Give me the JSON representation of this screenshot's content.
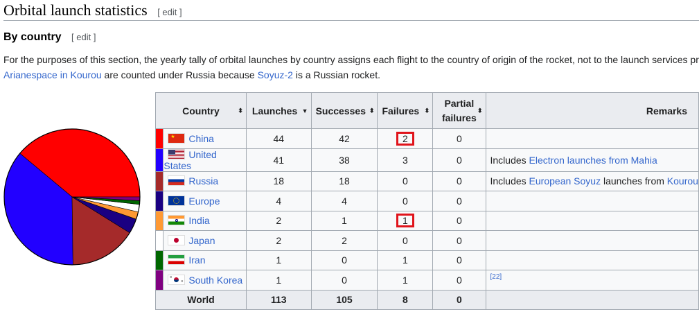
{
  "heading": {
    "title": "Orbital launch statistics",
    "edit": "[ edit ]"
  },
  "subheading": {
    "title": "By country",
    "edit": "[ edit ]"
  },
  "paragraph": {
    "line1": "For the purposes of this section, the yearly tally of orbital launches by country assigns each flight to the country of origin of the rocket, not to the launch services pr",
    "link1": "Arianespace in Kourou",
    "mid": " are counted under Russia because ",
    "link2": "Soyuz-2",
    "end": " is a Russian rocket."
  },
  "table": {
    "headers": {
      "country": "Country",
      "launches": "Launches",
      "successes": "Successes",
      "failures": "Failures",
      "partial1": "Partial",
      "partial2": "failures",
      "remarks": "Remarks"
    },
    "rows": [
      {
        "country": "China",
        "launches": "44",
        "successes": "42",
        "failures": "2",
        "partial": "0",
        "color": "#ff0000",
        "flag": "china"
      },
      {
        "country": "United States",
        "launches": "41",
        "successes": "38",
        "failures": "3",
        "partial": "0",
        "color": "#2200ff",
        "flag": "usa",
        "remark_pre": "Includes ",
        "remark_link": "Electron launches from Mahia",
        "remark_post": ""
      },
      {
        "country": "Russia",
        "launches": "18",
        "successes": "18",
        "failures": "0",
        "partial": "0",
        "color": "#a52a2a",
        "flag": "russia",
        "remark_pre": "Includes ",
        "remark_link": "European Soyuz",
        "remark_post": " launches from ",
        "remark_link2": "Kourou"
      },
      {
        "country": "Europe",
        "launches": "4",
        "successes": "4",
        "failures": "0",
        "partial": "0",
        "color": "#1a0082",
        "flag": "europe"
      },
      {
        "country": "India",
        "launches": "2",
        "successes": "1",
        "failures": "1",
        "partial": "0",
        "color": "#ff9933",
        "flag": "india"
      },
      {
        "country": "Japan",
        "launches": "2",
        "successes": "2",
        "failures": "0",
        "partial": "0",
        "color": "#ffffff",
        "flag": "japan"
      },
      {
        "country": "Iran",
        "launches": "1",
        "successes": "0",
        "failures": "1",
        "partial": "0",
        "color": "#006600",
        "flag": "iran"
      },
      {
        "country": "South Korea",
        "launches": "1",
        "successes": "0",
        "failures": "1",
        "partial": "0",
        "color": "#800080",
        "flag": "korea",
        "remark_ref": "[22]"
      }
    ],
    "world": {
      "label": "World",
      "launches": "113",
      "successes": "105",
      "failures": "8",
      "partial": "0"
    }
  },
  "colors": {
    "link": "#3366cc",
    "highlight_box": "#e0141b"
  }
}
